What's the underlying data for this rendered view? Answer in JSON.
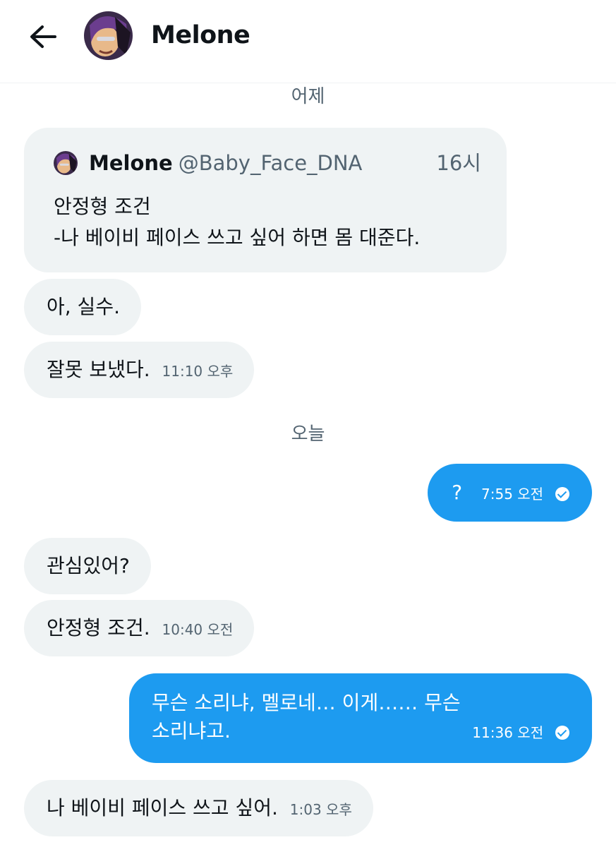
{
  "header": {
    "back_label": "←",
    "name": "Melone"
  },
  "quoted": {
    "name": "Melone",
    "handle": "@Baby_Face_DNA",
    "time": "16시",
    "line1": "안정형 조건",
    "line2": "-나 베이비 페이스 쓰고 싶어 하면 몸 대준다."
  },
  "days": {
    "yesterday": "어제",
    "today": "오늘"
  },
  "messages": [
    {
      "text": "아, 실수.",
      "time": ""
    },
    {
      "text": "잘못 보냈다.",
      "time": "11:10 오후"
    },
    {
      "text": "?",
      "time": "7:55 오전"
    },
    {
      "text": "관심있어?",
      "time": ""
    },
    {
      "text": "안정형 조건.",
      "time": "10:40 오전"
    },
    {
      "text_line1": "무슨 소리냐, 멜로네… 이게…… 무슨",
      "text_line2": "소리냐고.",
      "time": "11:36 오전"
    },
    {
      "text": "나 베이비 페이스 쓰고 싶어.",
      "time": "1:03 오후"
    }
  ],
  "colors": {
    "sent_bubble": "#1d9bf0",
    "received_bubble": "#eff3f4",
    "secondary_text": "#536471"
  },
  "icons": {
    "back": "arrow-left-icon",
    "read": "check-circle-icon"
  }
}
